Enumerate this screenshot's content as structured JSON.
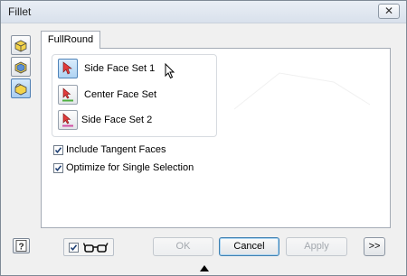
{
  "window": {
    "title": "Fillet",
    "close_label": "✕"
  },
  "toolbar": {
    "items": [
      {
        "icon": "edge-fillet-icon",
        "active": false
      },
      {
        "icon": "face-fillet-icon",
        "active": false
      },
      {
        "icon": "full-round-fillet-icon",
        "active": true
      }
    ]
  },
  "tab": {
    "label": "FullRound"
  },
  "selectors": [
    {
      "label": "Side Face Set 1",
      "icon": "select-arrow-icon",
      "active": true,
      "accent": "#3f7fd6"
    },
    {
      "label": "Center Face Set",
      "icon": "select-arrow-icon",
      "active": false,
      "accent": "#4fb040"
    },
    {
      "label": "Side Face Set 2",
      "icon": "select-arrow-icon",
      "active": false,
      "accent": "#d04fa4"
    }
  ],
  "options": {
    "include_tangent": {
      "label": "Include Tangent Faces",
      "checked": true
    },
    "optimize_single": {
      "label": "Optimize for Single Selection",
      "checked": true
    }
  },
  "footer": {
    "help_icon": "help-icon",
    "preview": {
      "checked": true,
      "icon": "glasses-icon"
    },
    "ok_label": "OK",
    "cancel_label": "Cancel",
    "apply_label": "Apply",
    "more_label": ">>"
  },
  "colors": {
    "accent_blue": "#3f7fd6",
    "selected_btn": "#aed3f3"
  }
}
